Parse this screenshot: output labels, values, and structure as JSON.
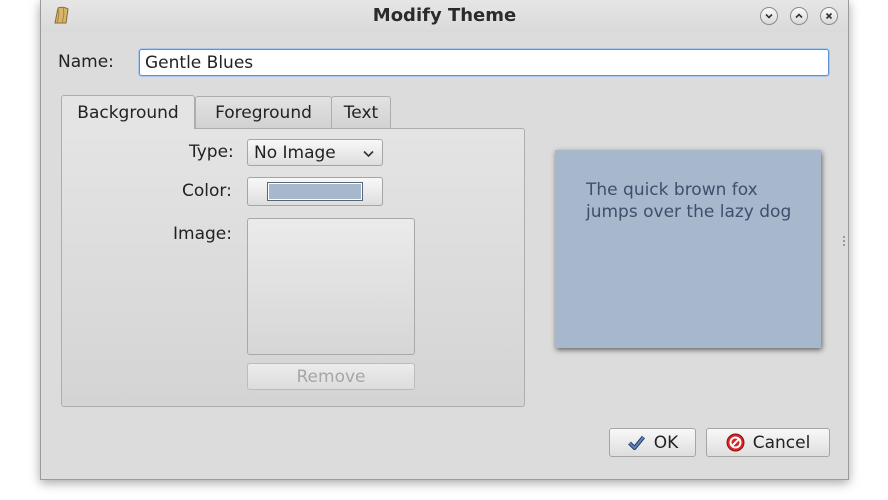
{
  "window": {
    "title": "Modify Theme",
    "controls": [
      "minimize-icon",
      "maximize-icon",
      "close-icon"
    ]
  },
  "name_field": {
    "label": "Name:",
    "value": "Gentle Blues"
  },
  "tabs": [
    {
      "label": "Background",
      "active": true
    },
    {
      "label": "Foreground",
      "active": false
    },
    {
      "label": "Text",
      "active": false
    }
  ],
  "background": {
    "type_label": "Type:",
    "type_value": "No Image",
    "color_label": "Color:",
    "color_value": "#a7b8cc",
    "image_label": "Image:",
    "remove_label": "Remove"
  },
  "preview": {
    "text": "The quick brown fox jumps over the lazy dog",
    "background_color": "#a7b8cc",
    "text_color": "#3d4f6b"
  },
  "buttons": {
    "ok": "OK",
    "cancel": "Cancel"
  }
}
